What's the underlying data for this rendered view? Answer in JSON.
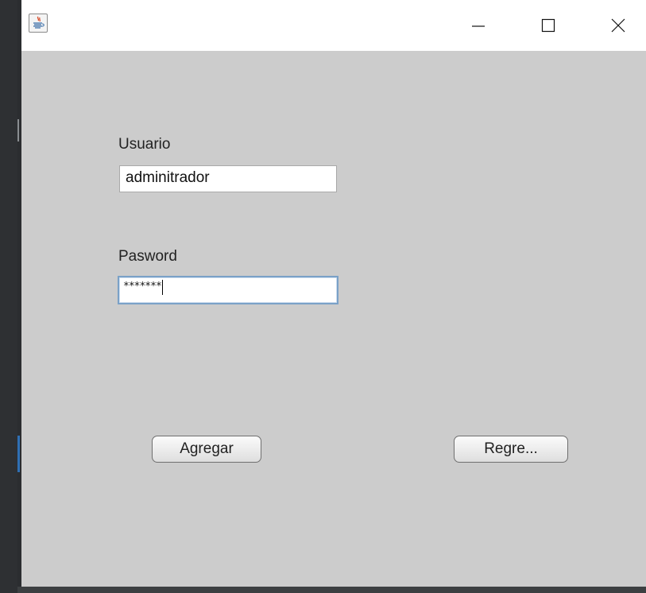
{
  "window": {
    "title_icon": "java-coffee-icon",
    "controls": {
      "minimize": "minimize-icon",
      "maximize": "maximize-icon",
      "close": "close-icon"
    }
  },
  "form": {
    "user_label": "Usuario",
    "user_value": "adminitrador",
    "password_label": "Pasword",
    "password_value": "*******"
  },
  "buttons": {
    "add_label": "Agregar",
    "back_label": "Regre..."
  },
  "colors": {
    "panel_bg": "#cccccc",
    "titlebar_bg": "#ffffff",
    "focus_border": "#7aa1c7"
  }
}
